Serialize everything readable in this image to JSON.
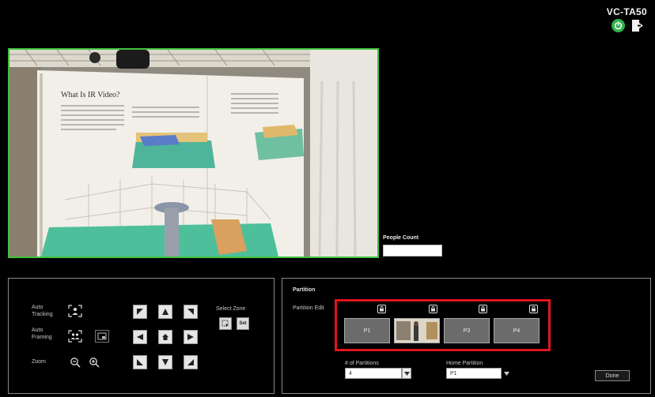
{
  "header": {
    "model": "VC-TA50",
    "power_icon": "power-icon",
    "exit_icon": "exit-icon",
    "power_color": "#2fb34a"
  },
  "video": {
    "border_color": "#3fc23f"
  },
  "people_count": {
    "label": "People Count",
    "value": ""
  },
  "controls": {
    "auto_tracking": "Auto\nTracking",
    "auto_framing": "Auto\nFraming",
    "zoom": "Zoom",
    "select_zone": "Select Zone",
    "set_label": "Set"
  },
  "partition": {
    "title": "Partition",
    "edit_label": "Partition Edit",
    "tiles": [
      "P1",
      "",
      "P3",
      "P4"
    ],
    "num_label": "# of Partitions",
    "num_value": "4",
    "home_label": "Home Partition",
    "home_value": "P1",
    "done_label": "Done",
    "highlight_color": "#e0141e"
  }
}
